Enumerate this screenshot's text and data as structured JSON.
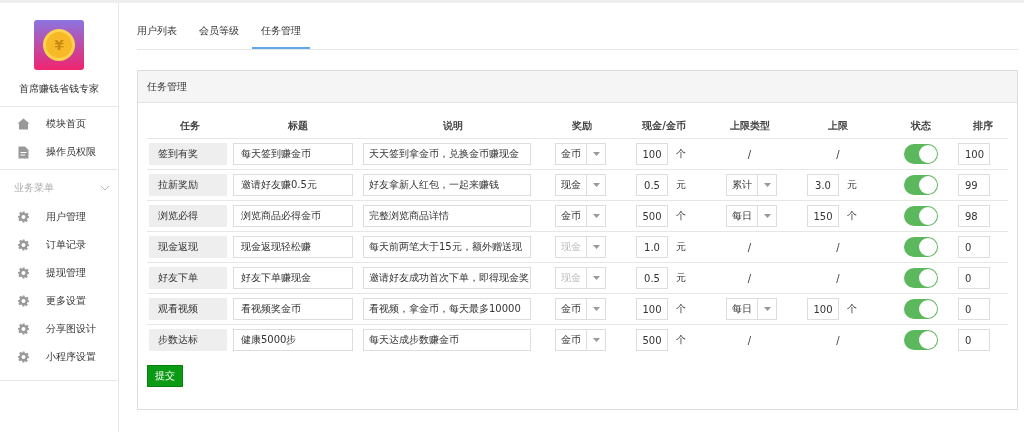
{
  "sidebar": {
    "logo_mark": "¥",
    "app_name": "首席赚钱省钱专家",
    "top_items": [
      "模块首页",
      "操作员权限"
    ],
    "section": {
      "title": "业务菜单",
      "expanded": true,
      "items": [
        "用户管理",
        "订单记录",
        "提现管理",
        "更多设置",
        "分享图设计",
        "小程序设置"
      ]
    }
  },
  "tabs": [
    {
      "label": "用户列表",
      "selected": false
    },
    {
      "label": "会员等级",
      "selected": false
    },
    {
      "label": "任务管理",
      "selected": true
    }
  ],
  "panel": {
    "title": "任务管理",
    "columns": [
      "任务",
      "标题",
      "说明",
      "奖励",
      "现金/金币",
      "上限类型",
      "上限",
      "状态",
      "排序"
    ],
    "rows": [
      {
        "task": "签到有奖",
        "title": "每天签到赚金币",
        "description": "天天签到拿金币，兑换金币赚现金",
        "reward": {
          "value": "金币",
          "disabled": false
        },
        "amount": "100",
        "amount_unit": "个",
        "limit_type": {
          "kind": "text",
          "value": "/"
        },
        "limit": {
          "kind": "text",
          "value": "/"
        },
        "on": true,
        "order": "100"
      },
      {
        "task": "拉新奖励",
        "title": "邀请好友赚0.5元",
        "description": "好友拿新人红包，一起来赚钱",
        "reward": {
          "value": "现金",
          "disabled": false
        },
        "amount": "0.5",
        "amount_unit": "元",
        "limit_type": {
          "kind": "select",
          "value": "累计"
        },
        "limit": {
          "kind": "input",
          "value": "3.0",
          "unit": "元"
        },
        "on": true,
        "order": "99"
      },
      {
        "task": "浏览必得",
        "title": "浏览商品必得金币",
        "description": "完整浏览商品详情",
        "reward": {
          "value": "金币",
          "disabled": false
        },
        "amount": "500",
        "amount_unit": "个",
        "limit_type": {
          "kind": "select",
          "value": "每日"
        },
        "limit": {
          "kind": "input",
          "value": "150",
          "unit": "个"
        },
        "on": true,
        "order": "98"
      },
      {
        "task": "现金返现",
        "title": "现金返现轻松赚",
        "description": "每天前两笔大于15元，额外赠送现",
        "reward": {
          "value": "现金",
          "disabled": true
        },
        "amount": "1.0",
        "amount_unit": "元",
        "limit_type": {
          "kind": "text",
          "value": "/"
        },
        "limit": {
          "kind": "text",
          "value": "/"
        },
        "on": true,
        "order": "0"
      },
      {
        "task": "好友下单",
        "title": "好友下单赚现金",
        "description": "邀请好友成功首次下单，即得现金奖",
        "reward": {
          "value": "现金",
          "disabled": true
        },
        "amount": "0.5",
        "amount_unit": "元",
        "limit_type": {
          "kind": "text",
          "value": "/"
        },
        "limit": {
          "kind": "text",
          "value": "/"
        },
        "on": true,
        "order": "0"
      },
      {
        "task": "观看视频",
        "title": "看视频奖金币",
        "description": "看视频，拿金币，每天最多10000",
        "reward": {
          "value": "金币",
          "disabled": false
        },
        "amount": "100",
        "amount_unit": "个",
        "limit_type": {
          "kind": "select",
          "value": "每日"
        },
        "limit": {
          "kind": "input",
          "value": "100",
          "unit": "个"
        },
        "on": true,
        "order": "0"
      },
      {
        "task": "步数达标",
        "title": "健康5000步",
        "description": "每天达成步数赚金币",
        "reward": {
          "value": "金币",
          "disabled": false
        },
        "amount": "500",
        "amount_unit": "个",
        "limit_type": {
          "kind": "text",
          "value": "/"
        },
        "limit": {
          "kind": "text",
          "value": "/"
        },
        "on": true,
        "order": "0"
      }
    ],
    "submit": "提交"
  }
}
